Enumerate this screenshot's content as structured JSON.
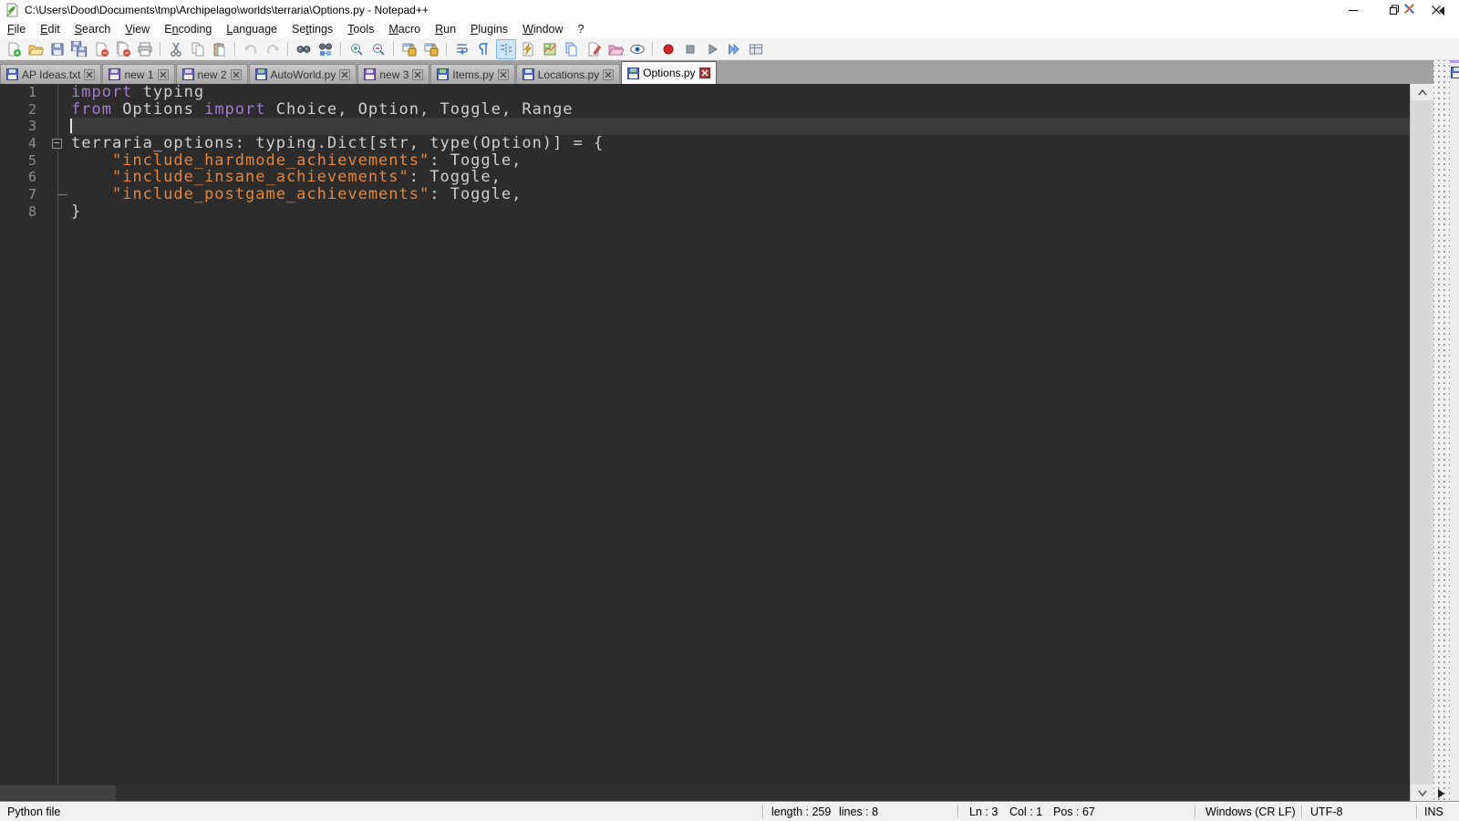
{
  "window": {
    "title": "C:\\Users\\Dood\\Documents\\tmp\\Archipelago\\worlds\\terraria\\Options.py - Notepad++",
    "controls": {
      "minimize": "minimize",
      "restore": "restore",
      "close": "close"
    }
  },
  "menu": {
    "items": [
      {
        "label": "File",
        "u": 0
      },
      {
        "label": "Edit",
        "u": 0
      },
      {
        "label": "Search",
        "u": 0
      },
      {
        "label": "View",
        "u": 0
      },
      {
        "label": "Encoding",
        "u": 1
      },
      {
        "label": "Language",
        "u": 0
      },
      {
        "label": "Settings",
        "u": 2
      },
      {
        "label": "Tools",
        "u": 0
      },
      {
        "label": "Macro",
        "u": 0
      },
      {
        "label": "Run",
        "u": 0
      },
      {
        "label": "Plugins",
        "u": 0
      },
      {
        "label": "Window",
        "u": 0
      },
      {
        "label": "?",
        "u": -1
      }
    ]
  },
  "toolbar": {
    "items": [
      {
        "icon": "new-file"
      },
      {
        "icon": "open-file"
      },
      {
        "icon": "save"
      },
      {
        "icon": "save-all"
      },
      {
        "icon": "close"
      },
      {
        "icon": "close-all"
      },
      {
        "icon": "print"
      },
      {
        "sep": true
      },
      {
        "icon": "cut"
      },
      {
        "icon": "copy"
      },
      {
        "icon": "paste"
      },
      {
        "sep": true
      },
      {
        "icon": "undo",
        "disabled": true
      },
      {
        "icon": "redo",
        "disabled": true
      },
      {
        "sep": true
      },
      {
        "icon": "find"
      },
      {
        "icon": "replace"
      },
      {
        "sep": true
      },
      {
        "icon": "zoom-in"
      },
      {
        "icon": "zoom-out"
      },
      {
        "sep": true
      },
      {
        "icon": "sync-vertical"
      },
      {
        "icon": "sync-horizontal"
      },
      {
        "sep": true
      },
      {
        "icon": "word-wrap"
      },
      {
        "icon": "show-all-characters"
      },
      {
        "icon": "indent-guide",
        "active": true
      },
      {
        "icon": "user-defined-language"
      },
      {
        "icon": "document-map"
      },
      {
        "icon": "document-list"
      },
      {
        "icon": "function-list"
      },
      {
        "icon": "folder-as-workspace"
      },
      {
        "icon": "document-monitoring"
      },
      {
        "sep": true
      },
      {
        "icon": "macro-record"
      },
      {
        "icon": "macro-stop"
      },
      {
        "icon": "macro-play"
      },
      {
        "icon": "macro-run-multiple"
      },
      {
        "icon": "macro-save"
      }
    ]
  },
  "tabs": [
    {
      "label": "AP Ideas.txt",
      "disk": "blue",
      "active": false
    },
    {
      "label": "new 1",
      "disk": "violet",
      "active": false
    },
    {
      "label": "new 2",
      "disk": "violet",
      "active": false
    },
    {
      "label": "AutoWorld.py",
      "disk": "green",
      "active": false
    },
    {
      "label": "new 3",
      "disk": "violet",
      "active": false
    },
    {
      "label": "Items.py",
      "disk": "green",
      "active": false
    },
    {
      "label": "Locations.py",
      "disk": "blue",
      "active": false
    },
    {
      "label": "Options.py",
      "disk": "green",
      "active": true
    }
  ],
  "editor": {
    "colors": {
      "background": "#2c2c2c",
      "current_line": "#3a3a3a",
      "keyword": "#a07ec9",
      "string": "#e3863e",
      "default": "#cfcfcf",
      "line_number": "#8d8d8d"
    },
    "lines": [
      {
        "n": 1,
        "segs": [
          {
            "c": "kw",
            "t": "import"
          },
          {
            "c": "pl",
            "t": " typing"
          }
        ]
      },
      {
        "n": 2,
        "segs": [
          {
            "c": "kw",
            "t": "from"
          },
          {
            "c": "pl",
            "t": " Options "
          },
          {
            "c": "kw",
            "t": "import"
          },
          {
            "c": "pl",
            "t": " Choice, Option, Toggle, Range"
          }
        ]
      },
      {
        "n": 3,
        "segs": [],
        "cursor": true,
        "current": true
      },
      {
        "n": 4,
        "segs": [
          {
            "c": "pl",
            "t": "terraria_options: typing.Dict[str, type(Option)] = {"
          }
        ],
        "fold": "open"
      },
      {
        "n": 5,
        "segs": [
          {
            "c": "pl",
            "t": "    "
          },
          {
            "c": "str",
            "t": "\"include_hardmode_achievements\""
          },
          {
            "c": "pl",
            "t": ": Toggle,"
          }
        ]
      },
      {
        "n": 6,
        "segs": [
          {
            "c": "pl",
            "t": "    "
          },
          {
            "c": "str",
            "t": "\"include_insane_achievements\""
          },
          {
            "c": "pl",
            "t": ": Toggle,"
          }
        ]
      },
      {
        "n": 7,
        "segs": [
          {
            "c": "pl",
            "t": "    "
          },
          {
            "c": "str",
            "t": "\"include_postgame_achievements\""
          },
          {
            "c": "pl",
            "t": ": Toggle,"
          }
        ],
        "guideEnd": true
      },
      {
        "n": 8,
        "segs": [
          {
            "c": "pl",
            "t": "}"
          }
        ]
      }
    ]
  },
  "status": {
    "doc_type": "Python file",
    "length_label": "length : 259",
    "lines_label": "lines : 8",
    "ln": "Ln : 3",
    "col": "Col : 1",
    "pos": "Pos : 67",
    "eol": "Windows (CR LF)",
    "encoding": "UTF-8",
    "typing_mode": "INS"
  }
}
